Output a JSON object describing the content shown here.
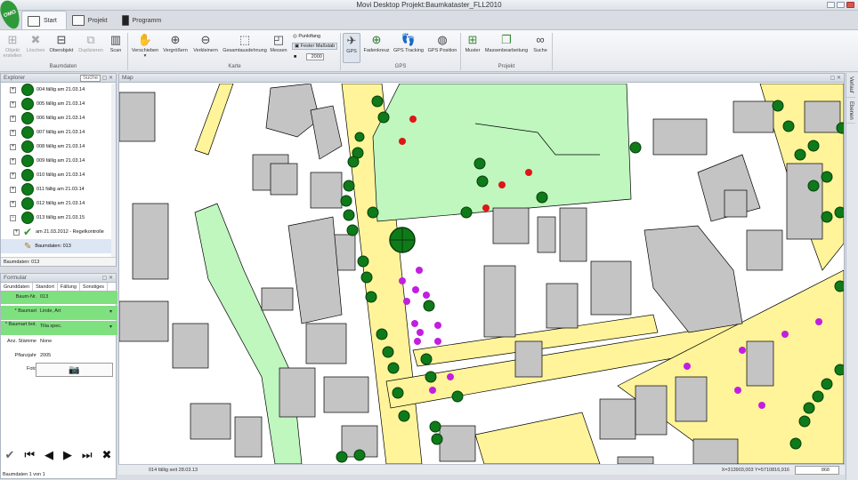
{
  "window": {
    "title": "Movi Desktop Projekt:Baumkataster_FLL2010"
  },
  "logo_text": "OMO",
  "tabs": [
    {
      "label": "Start"
    },
    {
      "label": "Projekt"
    },
    {
      "label": "Programm"
    }
  ],
  "ribbon": {
    "groups": {
      "baumdaten": "Baumdaten",
      "karte": "Karte",
      "gps": "GPS",
      "projekt": "Projekt"
    },
    "buttons": {
      "objekt_erstellen": "Objekt erstellen",
      "loeschen": "Löschen",
      "oberobjekt": "Oberobjekt",
      "duplizieren": "Duplizieren",
      "scan": "Scan",
      "verschieben": "Verschieben",
      "vergroessern": "Vergrößern",
      "verkleinern": "Verkleinern",
      "gesamtausdehnung": "Gesamtausdehnung",
      "messen": "Messen",
      "punktfang": "Punktfang",
      "fester_massstab": "Fester Maßstab",
      "massstab_value": "2000",
      "gps": "GPS",
      "fadenkreuz": "Fadenkreuz",
      "gps_tracking": "GPS Tracking",
      "gps_position": "GPS Position",
      "muster": "Muster",
      "massenbearbeitung": "Massenbearbeitung",
      "suche": "Suche"
    }
  },
  "explorer": {
    "title": "Explorer",
    "search_label": "Suche",
    "items": [
      {
        "label": "004 fällig am 21.03.14"
      },
      {
        "label": "005 fällig am 21.03.14"
      },
      {
        "label": "006 fällig am 21.03.14"
      },
      {
        "label": "007 fällig am 21.03.14"
      },
      {
        "label": "008 fällig am 21.03.14"
      },
      {
        "label": "009 fällig am 21.03.14"
      },
      {
        "label": "010 fällig am 21.03.14"
      },
      {
        "label": "011 fällig am 21.03.14"
      },
      {
        "label": "012 fällig am 21.03.14"
      },
      {
        "label": "013 fällig am 21.03.15"
      }
    ],
    "sub_item": "am 21.03.2012 - Regelkontrolle",
    "selected_item": "Baumdaten: 013",
    "status": "Baumdaten: 013"
  },
  "formular": {
    "title": "Formular",
    "tabs": [
      "Grunddaten",
      "Standort",
      "Fällung",
      "Sonstiges"
    ],
    "fields": {
      "baum_nr_label": "Baum-Nr.",
      "baum_nr_value": "013",
      "baumart_label": "* Baumart",
      "baumart_value": "Linde, Art",
      "baumart_bot_label": "* Baumart bot.",
      "baumart_bot_value": "Tilia spec.",
      "stamme_label": "Anz. Stämme",
      "stamme_value": "None",
      "pflanzjahr_label": "Pflanzjahr",
      "pflanzjahr_value": "2005",
      "foto_label": "Foto"
    },
    "status": "Baumdaten 1 von 1"
  },
  "map": {
    "title": "Map"
  },
  "statusbar": {
    "info": "014 fällig seit 28.03.13",
    "coords": "X=313903,003 Y=5710816,916",
    "scale": "868"
  },
  "rightbar": [
    "Verlauf",
    "Ebenen"
  ]
}
